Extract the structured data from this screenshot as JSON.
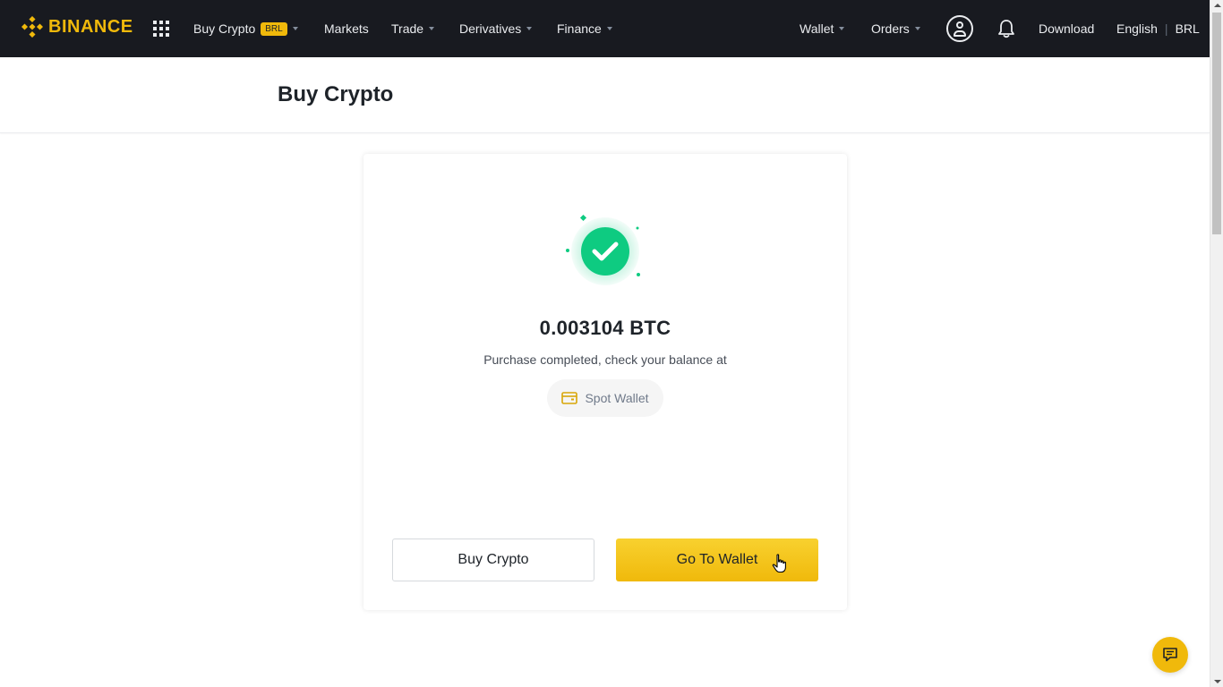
{
  "brand": {
    "name": "BINANCE",
    "accent": "#f0b90b",
    "nav_bg": "#181a20"
  },
  "nav": {
    "buy_crypto": "Buy Crypto",
    "buy_crypto_badge": "BRL",
    "markets": "Markets",
    "trade": "Trade",
    "derivatives": "Derivatives",
    "finance": "Finance",
    "wallet": "Wallet",
    "orders": "Orders",
    "download": "Download",
    "language": "English",
    "currency": "BRL"
  },
  "page": {
    "title": "Buy Crypto"
  },
  "result": {
    "amount": "0.003104 BTC",
    "message": "Purchase completed, check your balance at",
    "wallet_link": "Spot Wallet",
    "status_color": "#0ecb81"
  },
  "actions": {
    "secondary": "Buy Crypto",
    "primary": "Go To Wallet"
  },
  "icons": {
    "logo": "binance-logo-icon",
    "apps": "apps-grid-icon",
    "user": "user-icon",
    "notifications": "bell-icon",
    "wallet": "wallet-icon",
    "success": "check-circle-icon",
    "chat": "chat-icon"
  }
}
